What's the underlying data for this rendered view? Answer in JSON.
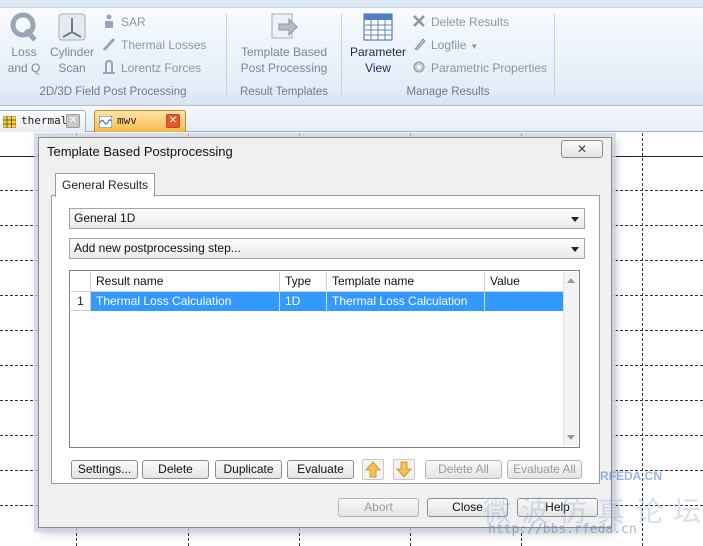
{
  "ribbon": {
    "groups": {
      "field_post": {
        "label": "2D/3D Field Post Processing",
        "loss": "Loss\nand Q",
        "cylinder": "Cylinder\nScan",
        "sar": "SAR",
        "thermal_losses": "Thermal Losses",
        "lorentz": "Lorentz Forces"
      },
      "templates": {
        "label": "Result Templates",
        "template_post": "Template Based\nPost Processing"
      },
      "manage": {
        "label": "Manage Results",
        "parameter_view": "Parameter\nView",
        "delete_results": "Delete Results",
        "logfile": "Logfile",
        "parametric": "Parametric Properties"
      }
    }
  },
  "tabs": [
    {
      "label": "thermal",
      "icon": "grid-icon"
    },
    {
      "label": "mwv",
      "icon": "waveform-icon"
    }
  ],
  "dialog": {
    "title": "Template Based Postprocessing",
    "panel_tab": "General Results",
    "combo_type": "General 1D",
    "combo_step": "Add new postprocessing step...",
    "columns": [
      "Result name",
      "Type",
      "Template name",
      "Value"
    ],
    "rows": [
      {
        "num": "1",
        "result_name": "Thermal Loss Calculation",
        "type": "1D",
        "template_name": "Thermal Loss Calculation",
        "value": ""
      }
    ],
    "buttons": {
      "settings": "Settings...",
      "delete": "Delete",
      "duplicate": "Duplicate",
      "evaluate": "Evaluate",
      "delete_all": "Delete All",
      "evaluate_all": "Evaluate All",
      "abort": "Abort",
      "close": "Close",
      "help": "Help"
    }
  },
  "watermark": {
    "brand": "RFEDA.CN",
    "url": "http://bbs.rfeda.cn"
  },
  "colors": {
    "selection": "#3399ff",
    "tab_active": "#f6b94a",
    "close_badge": "#e35a2a"
  }
}
